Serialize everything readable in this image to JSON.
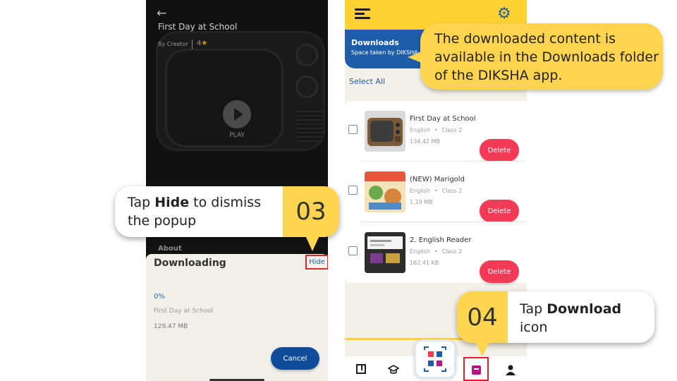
{
  "colors": {
    "accent_yellow": "#ffd232",
    "callout_yellow": "#ffd54f",
    "primary_blue": "#1e5ea9",
    "delete_red": "#f33a57",
    "highlight_red": "#e8212b"
  },
  "left_phone": {
    "back_icon": "arrow-left-icon",
    "title": "First Day at School",
    "by_label": "By",
    "creator": "Creator",
    "rating": "4",
    "rating_star": "★",
    "play_label": "PLAY",
    "about_label": "About",
    "sheet": {
      "title": "Downloading",
      "hide_label": "Hide",
      "progress": "0%",
      "content_name": "First Day at School",
      "size": "129.47 MB",
      "cancel_label": "Cancel"
    }
  },
  "right_phone": {
    "menu_icon": "hamburger-icon",
    "settings_icon": "gear-icon",
    "banner_title": "Downloads",
    "banner_sub": "Space taken by DIKSHA:",
    "select_all": "Select All",
    "items": [
      {
        "title": "First Day at School",
        "medium": "English",
        "class": "Class 2",
        "size": "134.42 MB",
        "delete_label": "Delete"
      },
      {
        "title": "(NEW) Marigold",
        "medium": "English",
        "class": "Class 2",
        "size": "1.19 MB",
        "delete_label": "Delete"
      },
      {
        "title": "2. English Reader",
        "medium": "English",
        "class": "Class 2",
        "size": "162.41 KB",
        "delete_label": "Delete"
      }
    ],
    "nav": {
      "library_icon": "book-icon",
      "courses_icon": "graduation-cap-icon",
      "qr_icon": "qr-scan-icon",
      "downloads_icon": "download-box-icon",
      "profile_icon": "person-icon"
    }
  },
  "callouts": {
    "downloads_info": "The downloaded content is available in the Downloads folder of the DIKSHA app.",
    "hide": {
      "prefix": "Tap ",
      "bold": "Hide",
      "suffix": " to dismiss the popup",
      "number": "03"
    },
    "download": {
      "prefix": "Tap ",
      "bold": "Download",
      "suffix": " icon",
      "number": "04"
    }
  }
}
